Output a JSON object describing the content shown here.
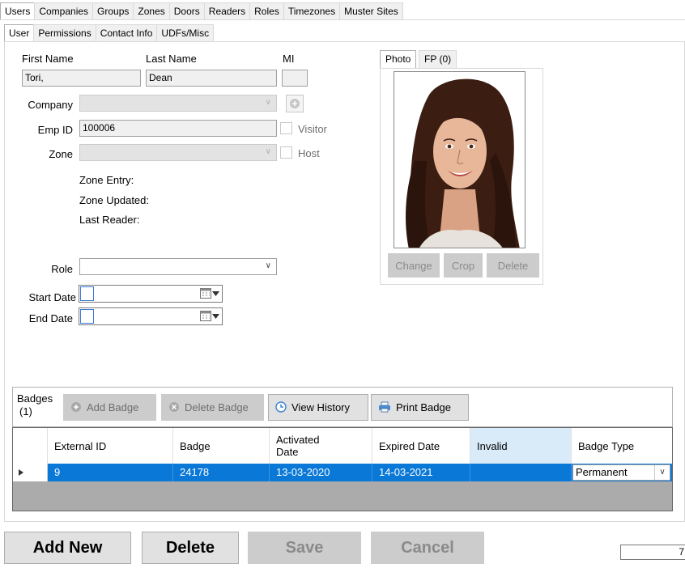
{
  "top_tabs": [
    "Users",
    "Companies",
    "Groups",
    "Zones",
    "Doors",
    "Readers",
    "Roles",
    "Timezones",
    "Muster Sites"
  ],
  "sub_tabs": [
    "User",
    "Permissions",
    "Contact Info",
    "UDFs/Misc"
  ],
  "form": {
    "first_name_label": "First Name",
    "first_name_value": "Tori,",
    "last_name_label": "Last Name",
    "last_name_value": "Dean",
    "mi_label": "MI",
    "mi_value": "",
    "company_label": "Company",
    "company_value": "",
    "emp_id_label": "Emp ID",
    "emp_id_value": "100006",
    "visitor_label": "Visitor",
    "zone_label": "Zone",
    "zone_value": "",
    "host_label": "Host",
    "zone_entry_label": "Zone Entry:",
    "zone_updated_label": "Zone Updated:",
    "last_reader_label": "Last Reader:",
    "role_label": "Role",
    "role_value": "",
    "start_date_label": "Start Date",
    "end_date_label": "End Date"
  },
  "photo": {
    "tabs": [
      "Photo",
      "FP (0)"
    ],
    "buttons": [
      "Change",
      "Crop",
      "Delete"
    ]
  },
  "badges": {
    "label_line1": "Badges",
    "label_line2": "(1)",
    "buttons": {
      "add": "Add Badge",
      "delete": "Delete Badge",
      "history": "View History",
      "print": "Print Badge"
    },
    "columns": {
      "external_id": "External ID",
      "badge": "Badge",
      "activated_line1": "Activated",
      "activated_line2": "Date",
      "expired": "Expired Date",
      "invalid": "Invalid",
      "badge_type": "Badge Type"
    },
    "rows": [
      {
        "external_id": "9",
        "badge": "24178",
        "activated": "13-03-2020",
        "expired": "14-03-2021",
        "invalid": "",
        "badge_type": "Permanent"
      }
    ]
  },
  "actions": {
    "add_new": "Add New",
    "delete": "Delete",
    "save": "Save",
    "cancel": "Cancel"
  },
  "pager_value": "7",
  "colors": {
    "selection": "#0a78d7",
    "invalid_header": "#d9ebf9",
    "disabled_button": "#cccccc"
  }
}
